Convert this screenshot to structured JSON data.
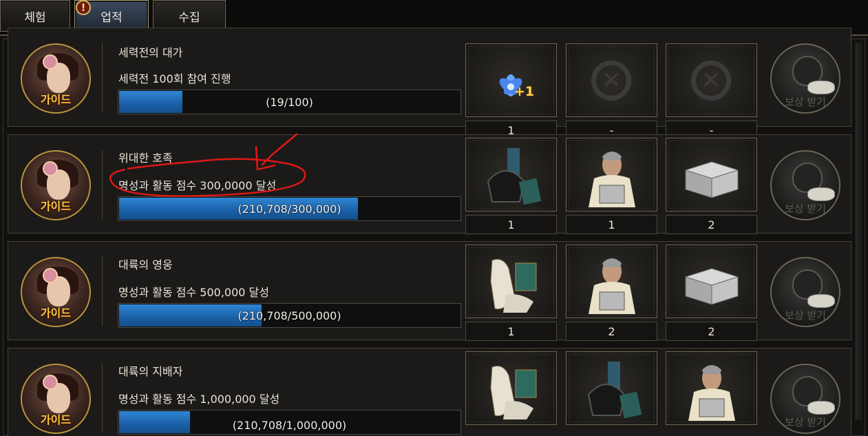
{
  "tabs": [
    {
      "label": "체험",
      "active": false
    },
    {
      "label": "업적",
      "active": true,
      "alert": "!"
    },
    {
      "label": "수집",
      "active": false
    }
  ],
  "achievements": [
    {
      "guide_label": "가이드",
      "title": "세력전의 대가",
      "description": "세력전 100회 참여 진행",
      "progress_text": "(19/100)",
      "progress": 0.19,
      "rewards": [
        {
          "icon": "blue-lotus-plus-one-icon",
          "badge": "+1",
          "qty": "1"
        },
        {
          "icon": "empty-slot-x-icon",
          "qty": "-"
        },
        {
          "icon": "empty-slot-x-icon",
          "qty": "-"
        }
      ],
      "reward_button": "보상 받기"
    },
    {
      "guide_label": "가이드",
      "title": "위대한 호족",
      "description": "명성과 활동 점수 300,0000 달성",
      "progress_text": "(210,708/300,000)",
      "progress": 0.702,
      "rewards": [
        {
          "icon": "helmet-armor-set-icon",
          "qty": "1"
        },
        {
          "icon": "elder-general-with-chest-icon",
          "qty": "1"
        },
        {
          "icon": "silver-treasure-chest-icon",
          "qty": "2"
        }
      ],
      "reward_button": "보상 받기"
    },
    {
      "guide_label": "가이드",
      "title": "대륙의 영웅",
      "description": "명성과 활동 점수 500,000 달성",
      "progress_text": "(210,708/500,000)",
      "progress": 0.421,
      "rewards": [
        {
          "icon": "white-warhorse-icon",
          "qty": "1"
        },
        {
          "icon": "elder-general-with-chest-icon",
          "qty": "2"
        },
        {
          "icon": "silver-treasure-chest-icon",
          "qty": "2"
        }
      ],
      "reward_button": "보상 받기"
    },
    {
      "guide_label": "가이드",
      "title": "대륙의 지배자",
      "description": "명성과 활동 점수 1,000,000 달성",
      "progress_text": "(210,708/1,000,000)",
      "progress": 0.211,
      "rewards": [
        {
          "icon": "white-warhorse-icon"
        },
        {
          "icon": "helmet-armor-set-icon"
        },
        {
          "icon": "elder-general-with-chest-icon"
        }
      ],
      "reward_button": "보상 받기"
    }
  ],
  "colors": {
    "progress": "#2f86d4",
    "accent_gold": "#ffcb3d",
    "annotation": "#e01818"
  }
}
